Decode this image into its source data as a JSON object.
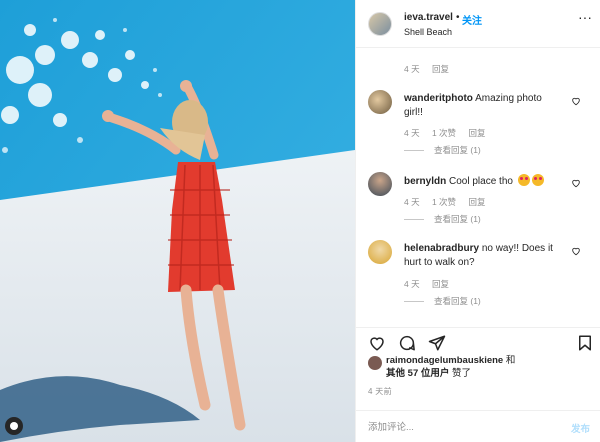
{
  "header": {
    "username": "ieva.travel",
    "dot": "•",
    "follow_label": "关注",
    "location": "Shell Beach",
    "more_label": "···"
  },
  "top_meta": {
    "age": "4 天",
    "reply": "回复"
  },
  "comments": [
    {
      "username": "wanderitphoto",
      "text": "Amazing photo girl!!",
      "age": "4 天",
      "likes": "1 次赞",
      "reply": "回复",
      "view_replies": "查看回复 (1)"
    },
    {
      "username": "bernyldn",
      "text": "Cool place tho",
      "age": "4 天",
      "likes": "1 次赞",
      "reply": "回复",
      "view_replies": "查看回复 (1)"
    },
    {
      "username": "helenabradbury",
      "text": "no way!! Does it hurt to walk on?",
      "age": "4 天",
      "reply": "回复",
      "view_replies": "查看回复 (1)"
    }
  ],
  "likes": {
    "username": "raimondagelumbauskiene",
    "and": "和",
    "rest_prefix": "其他",
    "count": "57 位用户",
    "rest_suffix": "赞了"
  },
  "post_age": "4 天前",
  "composer": {
    "placeholder": "添加评论...",
    "post_label": "发布"
  },
  "colors": {
    "link": "#0095f6",
    "sky": "#2aa7dd",
    "dress": "#e23b2e"
  },
  "icons": [
    "heart-icon",
    "comment-icon",
    "share-icon",
    "bookmark-icon",
    "more-icon"
  ]
}
